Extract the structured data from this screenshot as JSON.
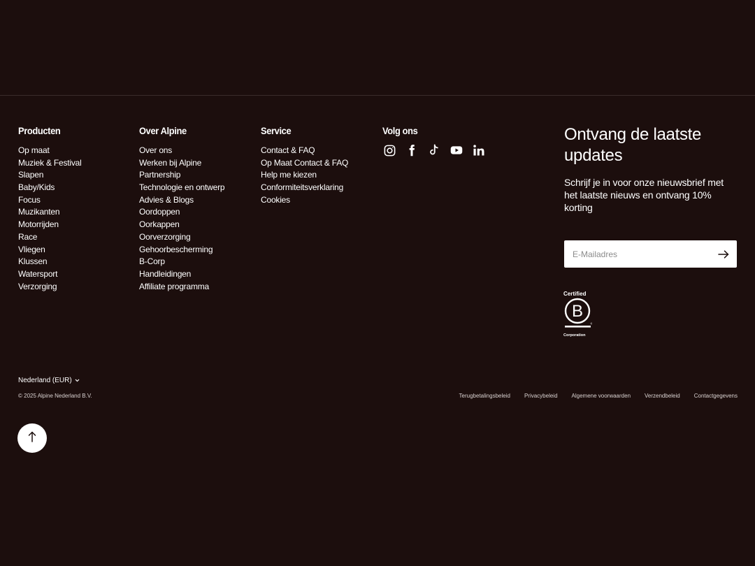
{
  "columns": {
    "products": {
      "heading": "Producten",
      "items": [
        "Op maat",
        "Muziek & Festival",
        "Slapen",
        "Baby/Kids",
        "Focus",
        "Muzikanten",
        "Motorrijden",
        "Race",
        "Vliegen",
        "Klussen",
        "Watersport",
        "Verzorging"
      ]
    },
    "about": {
      "heading": "Over Alpine",
      "items": [
        "Over ons",
        "Werken bij Alpine",
        "Partnership",
        "Technologie en ontwerp",
        "Advies & Blogs",
        "Oordoppen",
        "Oorkappen",
        "Oorverzorging",
        "Gehoorbescherming",
        "B-Corp",
        "Handleidingen",
        "Affiliate programma"
      ]
    },
    "service": {
      "heading": "Service",
      "items": [
        "Contact & FAQ",
        "Op Maat Contact & FAQ",
        "Help me kiezen",
        "Conformiteitsverklaring",
        "Cookies"
      ]
    },
    "social": {
      "heading": "Volg ons",
      "icons": [
        "instagram-icon",
        "facebook-icon",
        "tiktok-icon",
        "youtube-icon",
        "linkedin-icon"
      ]
    }
  },
  "newsletter": {
    "title": "Ontvang de laatste updates",
    "text": "Schrijf je in voor onze nieuwsbrief met het laatste nieuws en ontvang 10% korting",
    "email_placeholder": "E-Mailadres",
    "submit_icon": "arrow-right-icon"
  },
  "bcorp": {
    "top": "Certified",
    "letter": "B",
    "bottom": "Corporation"
  },
  "footer_bottom": {
    "country": "Nederland (EUR)",
    "copyright": "© 2025 Alpine Nederland B.V.",
    "legal_links": [
      "Terugbetalingsbeleid",
      "Privacybeleid",
      "Algemene voorwaarden",
      "Verzendbeleid",
      "Contactgegevens"
    ]
  },
  "scroll_top_icon": "arrow-up-icon",
  "colors": {
    "background": "#1c0e0d",
    "text": "#ffffff",
    "divider": "#3a2b2a"
  }
}
